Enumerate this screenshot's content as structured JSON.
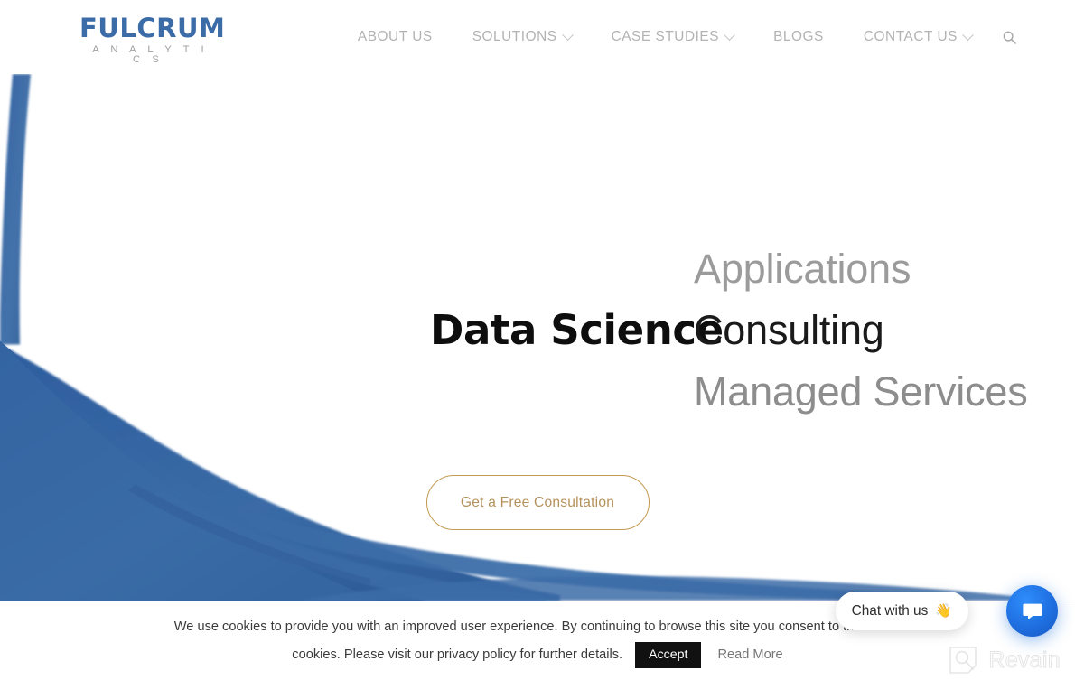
{
  "site": {
    "brand_primary": "#3c6ca8",
    "accent_gold": "#b5915a",
    "logo_main": "FULCRUM",
    "logo_sub": "A N A L Y T I C S"
  },
  "header": {
    "nav": [
      {
        "label": "ABOUT US",
        "has_dropdown": false
      },
      {
        "label": "SOLUTIONS",
        "has_dropdown": true
      },
      {
        "label": "CASE STUDIES",
        "has_dropdown": true
      },
      {
        "label": "BLOGS",
        "has_dropdown": false
      },
      {
        "label": "CONTACT US",
        "has_dropdown": true
      }
    ],
    "search_icon": "search-icon"
  },
  "hero": {
    "static_headline": "Data Science",
    "rotating_lines": [
      {
        "text": "Applications",
        "state": "dim"
      },
      {
        "text": "Consulting",
        "state": "active"
      },
      {
        "text": "Managed Services",
        "state": "dim"
      }
    ],
    "cta_label": "Get a Free Consultation"
  },
  "cookie_notice": {
    "line_one": "We use cookies to provide you with an improved user experience. By continuing to browse this site you consent to the use of",
    "line_two": "cookies. Please visit our privacy policy for further details.",
    "accept_label": "Accept",
    "read_more_label": "Read More"
  },
  "chat_widget": {
    "bubble_text": "Chat with us",
    "bubble_emoji": "👋",
    "launcher_icon": "chat-bubble-icon"
  },
  "watermark": {
    "text": "Revain",
    "icon": "revain-logo-icon"
  }
}
